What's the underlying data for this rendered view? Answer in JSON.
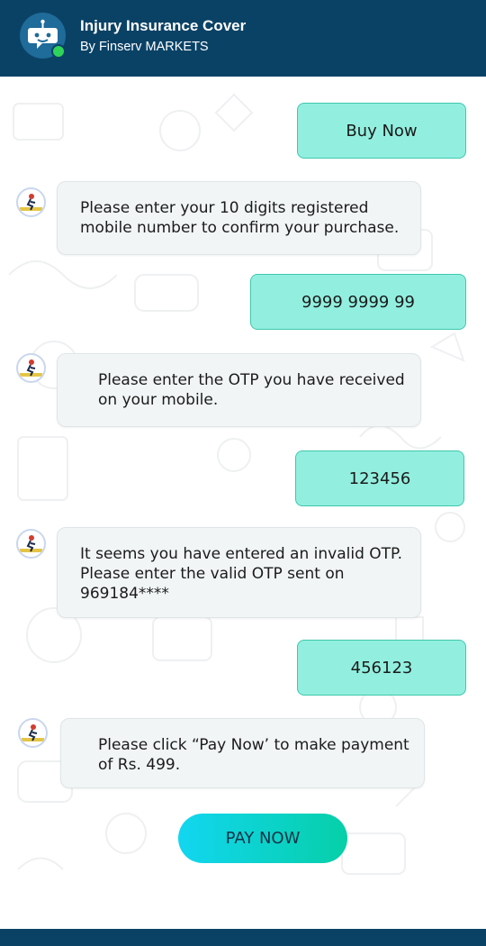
{
  "header": {
    "title": "Injury Insurance Cover",
    "subtitle": "By Finserv MARKETS",
    "bot_icon": "chatbot-icon",
    "status": "online"
  },
  "messages": [
    {
      "sender": "user",
      "text": "Buy Now"
    },
    {
      "sender": "bot",
      "text": "Please enter your 10 digits registered mobile number to confirm your purchase."
    },
    {
      "sender": "user",
      "text": "9999 9999 99"
    },
    {
      "sender": "bot",
      "text": "Please enter the OTP you have received on your mobile."
    },
    {
      "sender": "user",
      "text": "123456"
    },
    {
      "sender": "bot",
      "text": " It seems you have entered an invalid OTP. Please enter the valid OTP sent on 969184****"
    },
    {
      "sender": "user",
      "text": "456123"
    },
    {
      "sender": "bot",
      "text": "Please click “Pay Now’ to make payment of Rs. 499."
    }
  ],
  "pay_button": {
    "label": "PAY NOW"
  },
  "colors": {
    "header_bg": "#0a4266",
    "user_bubble": "#92efdf",
    "bot_bubble": "#f1f5f6",
    "online": "#2fd35a",
    "pay_gradient_start": "#12d6f0",
    "pay_gradient_end": "#06cfa8"
  }
}
